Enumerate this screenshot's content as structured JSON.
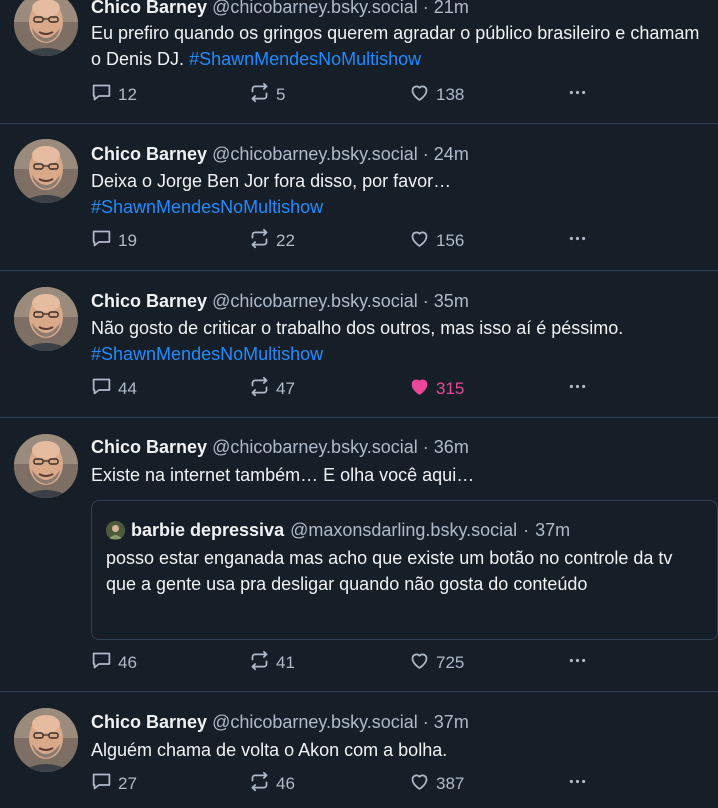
{
  "posts": [
    {
      "author": "Chico Barney",
      "handle": "@chicobarney.bsky.social",
      "time": "21m",
      "text": "Eu prefiro quando os gringos querem agradar o público brasileiro e chamam o Denis DJ.",
      "hashtag": "#ShawnMendesNoMultishow",
      "replies": "12",
      "reposts": "5",
      "likes": "138",
      "liked": false
    },
    {
      "author": "Chico Barney",
      "handle": "@chicobarney.bsky.social",
      "time": "24m",
      "text": "Deixa o Jorge Ben Jor fora disso, por favor…",
      "hashtag": "#ShawnMendesNoMultishow",
      "replies": "19",
      "reposts": "22",
      "likes": "156",
      "liked": false
    },
    {
      "author": "Chico Barney",
      "handle": "@chicobarney.bsky.social",
      "time": "35m",
      "text": "Não gosto de criticar o trabalho dos outros, mas isso aí é péssimo.",
      "hashtag": "#ShawnMendesNoMultishow",
      "replies": "44",
      "reposts": "47",
      "likes": "315",
      "liked": true
    },
    {
      "author": "Chico Barney",
      "handle": "@chicobarney.bsky.social",
      "time": "36m",
      "text": "Existe na internet também… E olha você aqui…",
      "quote": {
        "author": "barbie depressiva",
        "handle": "@maxonsdarling.bsky.social",
        "time": "37m",
        "text": "posso estar enganada mas acho que existe um botão no controle da tv que a gente usa pra desligar quando não gosta do conteúdo"
      },
      "replies": "46",
      "reposts": "41",
      "likes": "725",
      "liked": false
    },
    {
      "author": "Chico Barney",
      "handle": "@chicobarney.bsky.social",
      "time": "37m",
      "text": "Alguém chama de volta o Akon com a bolha.",
      "replies": "27",
      "reposts": "46",
      "likes": "387",
      "liked": false
    }
  ],
  "separator": "·",
  "colors": {
    "background": "#161e27",
    "text": "#f1f3f5",
    "muted": "#aebbc9",
    "link": "#208bfe",
    "like_active": "#ec4899",
    "border": "#2e4052"
  },
  "icons": {
    "reply": "reply-icon",
    "repost": "repost-icon",
    "like": "heart-icon",
    "more": "more-options-icon"
  }
}
